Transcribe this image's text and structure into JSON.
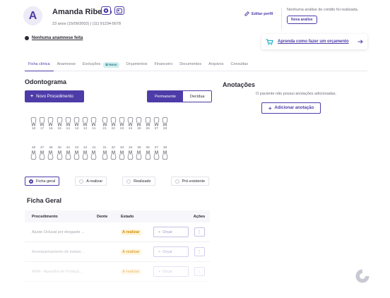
{
  "patient": {
    "initial": "A",
    "name": "Amanda Ribeiro",
    "info": "23 anos (15/09/2002) | (11) 91234-5678",
    "anamnese_notice": "Nenhuma anamnese feita"
  },
  "header": {
    "edit_profile": "Editar perfil",
    "credit_text": "Nenhuma análise de crédito foi realizada.",
    "new_analysis": "Nova análise",
    "howto": "Aprenda como fazer um orçamento"
  },
  "tabs": [
    {
      "label": "Ficha clínica"
    },
    {
      "label": "Anamnese"
    },
    {
      "label": "Evoluções",
      "badge": "Novo"
    },
    {
      "label": "Orçamentos"
    },
    {
      "label": "Financeiro"
    },
    {
      "label": "Documentos"
    },
    {
      "label": "Arquivos"
    },
    {
      "label": "Consultas"
    }
  ],
  "odontograma": {
    "title": "Odontograma",
    "new_procedure": "Novo Procedimento",
    "toggle": {
      "permanente": "Permanente",
      "decidua": "Decídua"
    },
    "upper_teeth": [
      "18",
      "17",
      "16",
      "15",
      "14",
      "13",
      "12",
      "11",
      "21",
      "22",
      "23",
      "24",
      "25",
      "26",
      "27",
      "28"
    ],
    "lower_teeth": [
      "48",
      "47",
      "46",
      "45",
      "44",
      "43",
      "42",
      "41",
      "31",
      "32",
      "33",
      "34",
      "35",
      "36",
      "37",
      "38"
    ]
  },
  "filters": [
    "Ficha geral",
    "A realizar",
    "Realizado",
    "Pré-existente"
  ],
  "ficha": {
    "title": "Ficha Geral",
    "headers": {
      "procedimento": "Procedimento",
      "dente": "Dente",
      "estado": "Estado",
      "acoes": "Ações"
    },
    "rows": [
      {
        "procedimento": "Ajuste Oclusal por desgaste ...",
        "dente": "",
        "estado": "A realizar",
        "orcar": "Orçar"
      },
      {
        "procedimento": "Acompanhamento de tratam...",
        "dente": "",
        "estado": "A realizar",
        "orcar": "Orçar"
      },
      {
        "procedimento": "ARM - Aparelho de Proteçã...",
        "dente": "",
        "estado": "A realizar",
        "orcar": "Orçar"
      }
    ]
  },
  "anotacoes": {
    "title": "Anotações",
    "empty": "O paciente não possui anotações adicionadas.",
    "add_button": "Adicionar anotação"
  },
  "colors": {
    "accent": "#4d3ca8",
    "status": "#d48a00"
  }
}
